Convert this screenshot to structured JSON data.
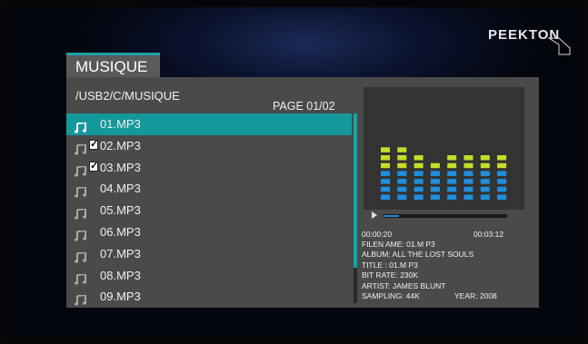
{
  "brand": {
    "logo_text": "PEEKTON"
  },
  "tab": {
    "label": "MUSIQUE"
  },
  "browser": {
    "path": "/USB2/C/MUSIQUE",
    "page_label": "PAGE 01/02",
    "files": [
      {
        "name": "01.MP3",
        "selected": true,
        "checked": false
      },
      {
        "name": "02.MP3",
        "selected": false,
        "checked": true
      },
      {
        "name": "03.MP3",
        "selected": false,
        "checked": true
      },
      {
        "name": "04.MP3",
        "selected": false,
        "checked": false
      },
      {
        "name": "05.MP3",
        "selected": false,
        "checked": false
      },
      {
        "name": "06.MP3",
        "selected": false,
        "checked": false
      },
      {
        "name": "07.MP3",
        "selected": false,
        "checked": false
      },
      {
        "name": "08.MP3",
        "selected": false,
        "checked": false
      },
      {
        "name": "09.MP3",
        "selected": false,
        "checked": false
      }
    ]
  },
  "player": {
    "elapsed": "00:00:20",
    "duration": "00:03:12",
    "progress_fraction": 0.12,
    "equalizer_levels": [
      7,
      7,
      6,
      5,
      6,
      6,
      6,
      6
    ],
    "equalizer_max": 8,
    "colors": {
      "eq_low": "#1f8fde",
      "eq_high": "#c8dc2a",
      "accent": "#15989c"
    }
  },
  "info": {
    "filename": "FILEN AME: 01.M P3",
    "album": "ALBUM: ALL THE LOST SOULS",
    "title": "TITLE : 01.M P3",
    "bitrate": "BIT RATE: 230K",
    "artist": "ARTIST: JAMES BLUNT",
    "sampling": "SAMPLING: 44K",
    "year": "YEAR: 2008"
  },
  "icons": {
    "file": "music-note-icon",
    "play": "play-triangle-icon",
    "check": "checkbox-icon"
  }
}
